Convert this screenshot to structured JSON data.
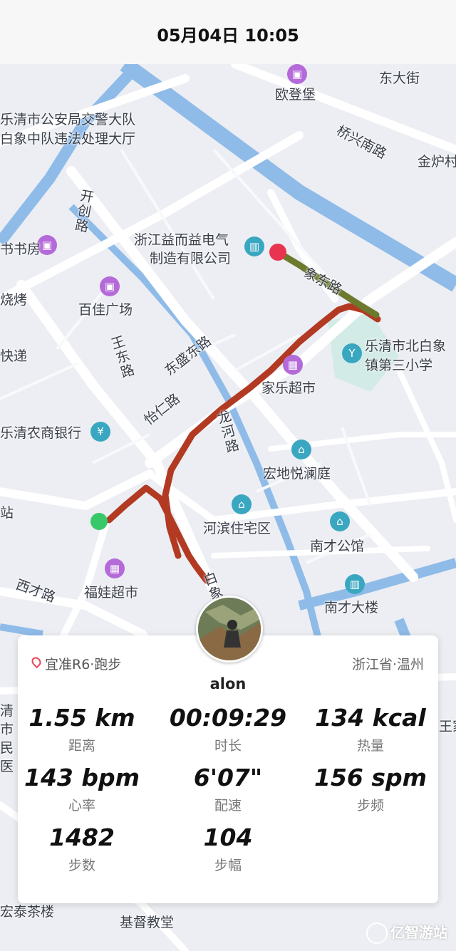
{
  "header": {
    "datetime": "05月04日 10:05"
  },
  "map": {
    "labels": {
      "dongdajie": "东大街",
      "oudengbao": "欧登堡",
      "police1": "乐清市公安局交警大队",
      "police2": "白象中队违法处理大厅",
      "qiaoxingnanlu": "桥兴南路",
      "jinlu": "金炉村",
      "kaichuanglu": "开创路",
      "bookstore": "书书房",
      "company1": "浙江益而益电气",
      "company2": "制造有限公司",
      "shaokao": "烧烤",
      "baijia": "百佳广场",
      "xiangdonglu": "象东路",
      "school1": "乐清市北白象",
      "school2": "镇第三小学",
      "kuaidi": "快递",
      "wangdonglu": "王东路",
      "dongshenglu": "东盛东路",
      "jiale": "家乐超市",
      "yirenlu": "怡仁路",
      "bank": "乐清农商银行",
      "longhelu": "龙河路",
      "hongdi": "宏地悦澜庭",
      "hebin": "河滨住宅区",
      "nancai_gongguan": "南才公馆",
      "xicailu": "西才路",
      "fuwa": "福娃超市",
      "baixianglu": "白象",
      "nancai_dalou": "南才大楼",
      "qingmin": "清市民医",
      "wang": "王家",
      "hongtai": "宏泰茶楼",
      "jidu": "基督教堂",
      "zhan": "站"
    },
    "route_colors": {
      "main": "#b23a22",
      "highlight": "#6b7a2c",
      "start": "#37c86a",
      "end": "#e8344e"
    }
  },
  "card": {
    "device": "宜准R6·跑步",
    "region": "浙江省·温州",
    "username": "alon",
    "stats": {
      "distance": {
        "value": "1.55 km",
        "label": "距离"
      },
      "duration": {
        "value": "00:09:29",
        "label": "时长"
      },
      "calories": {
        "value": "134 kcal",
        "label": "热量"
      },
      "heart_rate": {
        "value": "143 bpm",
        "label": "心率"
      },
      "pace": {
        "value": "6'07\"",
        "label": "配速"
      },
      "cadence": {
        "value": "156 spm",
        "label": "步频"
      },
      "steps": {
        "value": "1482",
        "label": "步数"
      },
      "stride": {
        "value": "104",
        "label": "步幅"
      }
    }
  },
  "watermark": "亿智游站"
}
